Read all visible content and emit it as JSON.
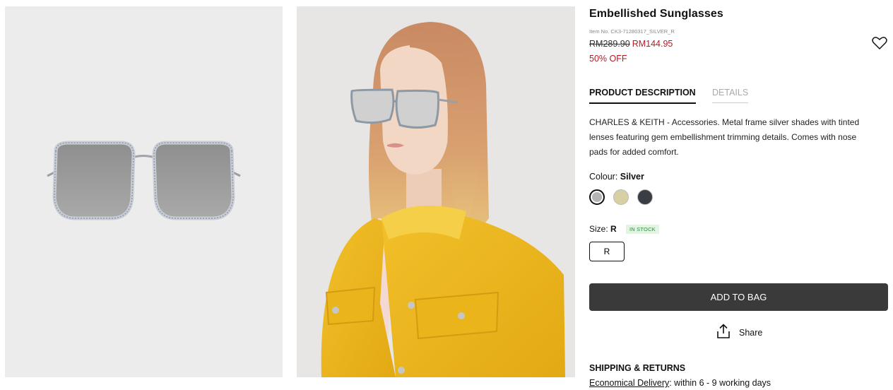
{
  "product": {
    "title": "Embellished Sunglasses",
    "item_no": "Item No. CK3-71280317_SILVER_R",
    "price_original": "RM289.90",
    "price_sale": "RM144.95",
    "discount": "50% OFF"
  },
  "tabs": [
    {
      "label": "PRODUCT DESCRIPTION",
      "active": true
    },
    {
      "label": "DETAILS",
      "active": false
    }
  ],
  "description": "CHARLES & KEITH - Accessories. Metal frame silver shades with tinted lenses featuring gem embellishment trimming details. Comes with nose pads for added comfort.",
  "colour": {
    "label": "Colour:",
    "selected": "Silver",
    "swatches": [
      {
        "name": "silver",
        "color": "#b4b4b4",
        "selected": true
      },
      {
        "name": "gold",
        "color": "#d9cfa4",
        "selected": false
      },
      {
        "name": "dark",
        "color": "#3a3d43",
        "selected": false
      }
    ]
  },
  "size": {
    "label": "Size:",
    "selected": "R",
    "stock": "IN STOCK",
    "options": [
      "R"
    ]
  },
  "actions": {
    "add_to_bag": "ADD TO BAG",
    "share": "Share"
  },
  "shipping": {
    "heading": "SHIPPING & RETURNS",
    "link": "Economical Delivery",
    "text": ": within 6 - 9 working days"
  },
  "colors": {
    "sale": "#b31b25",
    "button": "#3a3a3a",
    "stock_bg": "#e3f4e4",
    "stock_text": "#2f8a3a"
  }
}
